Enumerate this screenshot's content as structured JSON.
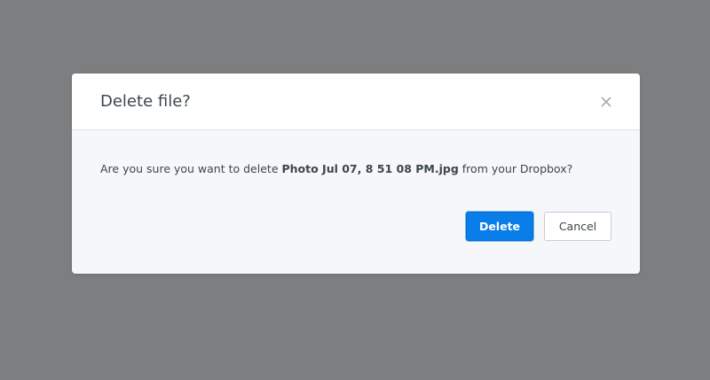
{
  "dialog": {
    "title": "Delete file?",
    "close_icon": "close-icon",
    "message_prefix": "Are you sure you want to delete ",
    "file_name": "Photo Jul 07, 8 51 08 PM.jpg",
    "message_suffix": " from your Dropbox?",
    "delete_label": "Delete",
    "cancel_label": "Cancel"
  },
  "colors": {
    "backdrop": "#7d7e80",
    "dialog_body": "#f5f7fa",
    "primary_button": "#0a7ee8",
    "text": "#3d464d"
  }
}
